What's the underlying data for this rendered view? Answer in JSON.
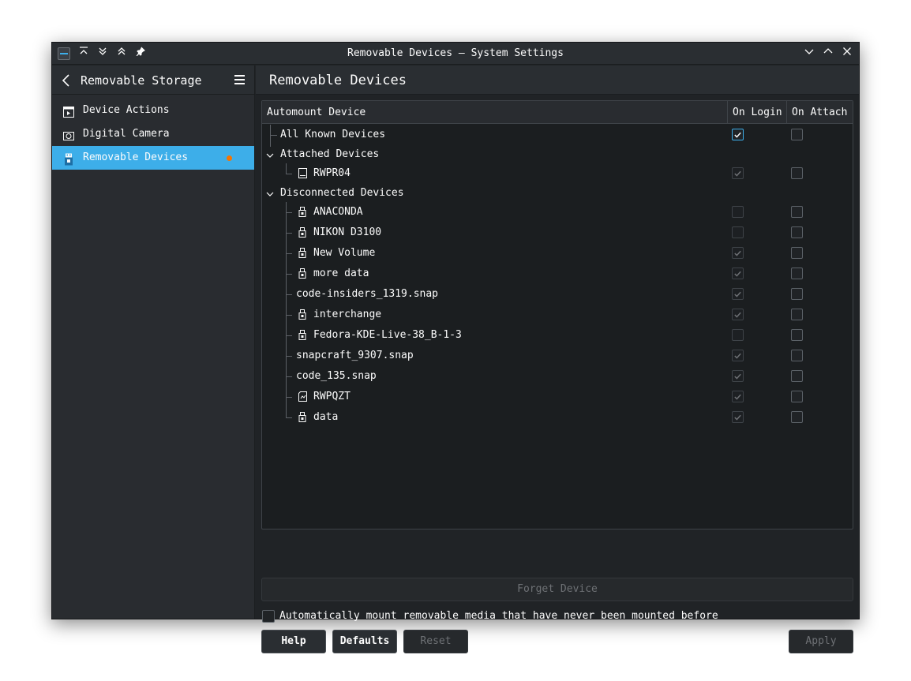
{
  "window": {
    "title": "Removable Devices — System Settings"
  },
  "sidebar": {
    "header_title": "Removable Storage",
    "items": [
      {
        "label": "Device Actions",
        "icon": "play-box-icon"
      },
      {
        "label": "Digital Camera",
        "icon": "camera-icon"
      },
      {
        "label": "Removable Devices",
        "icon": "usb-drive-icon",
        "active": true,
        "modified_indicator": true
      }
    ]
  },
  "main": {
    "title": "Removable Devices",
    "columns": [
      "Automount Device",
      "On Login",
      "On Attach"
    ],
    "tree": [
      {
        "label": "All Known Devices",
        "level": 0,
        "on_login": true,
        "on_login_enabled": true,
        "on_attach": false
      },
      {
        "label": "Attached Devices",
        "level": 0,
        "group": true,
        "expanded": true
      },
      {
        "label": "RWPR04",
        "level": 1,
        "icon": "drive-icon",
        "on_login": true,
        "on_login_enabled": false,
        "on_attach": false
      },
      {
        "label": "Disconnected Devices",
        "level": 0,
        "group": true,
        "expanded": true
      },
      {
        "label": "ANACONDA",
        "level": 1,
        "icon": "usb-icon",
        "on_login": false,
        "on_login_enabled": false,
        "on_attach": false
      },
      {
        "label": "NIKON D3100",
        "level": 1,
        "icon": "usb-icon",
        "on_login": false,
        "on_login_enabled": false,
        "on_attach": false
      },
      {
        "label": "New Volume",
        "level": 1,
        "icon": "usb-icon",
        "on_login": true,
        "on_login_enabled": false,
        "on_attach": false
      },
      {
        "label": "more data",
        "level": 1,
        "icon": "usb-icon",
        "on_login": true,
        "on_login_enabled": false,
        "on_attach": false
      },
      {
        "label": "code-insiders_1319.snap",
        "level": 1,
        "icon": "",
        "on_login": true,
        "on_login_enabled": false,
        "on_attach": false
      },
      {
        "label": "interchange",
        "level": 1,
        "icon": "usb-icon",
        "on_login": true,
        "on_login_enabled": false,
        "on_attach": false
      },
      {
        "label": "Fedora-KDE-Live-38_B-1-3",
        "level": 1,
        "icon": "usb-icon",
        "on_login": false,
        "on_login_enabled": false,
        "on_attach": false
      },
      {
        "label": "snapcraft_9307.snap",
        "level": 1,
        "icon": "",
        "on_login": true,
        "on_login_enabled": false,
        "on_attach": false
      },
      {
        "label": "code_135.snap",
        "level": 1,
        "icon": "",
        "on_login": true,
        "on_login_enabled": false,
        "on_attach": false
      },
      {
        "label": "RWPQZT",
        "level": 1,
        "icon": "sdcard-icon",
        "on_login": true,
        "on_login_enabled": false,
        "on_attach": false
      },
      {
        "label": "data",
        "level": 1,
        "icon": "usb-icon",
        "on_login": true,
        "on_login_enabled": false,
        "on_attach": false
      }
    ],
    "forget_button": "Forget Device",
    "auto_mount_label": "Automatically mount removable media that have never been mounted before",
    "auto_mount_checked": false
  },
  "buttons": {
    "help": "Help",
    "defaults": "Defaults",
    "reset": "Reset",
    "apply": "Apply"
  },
  "colors": {
    "accent": "#3daee9",
    "modified_dot": "#f67400",
    "background": "#202326"
  }
}
